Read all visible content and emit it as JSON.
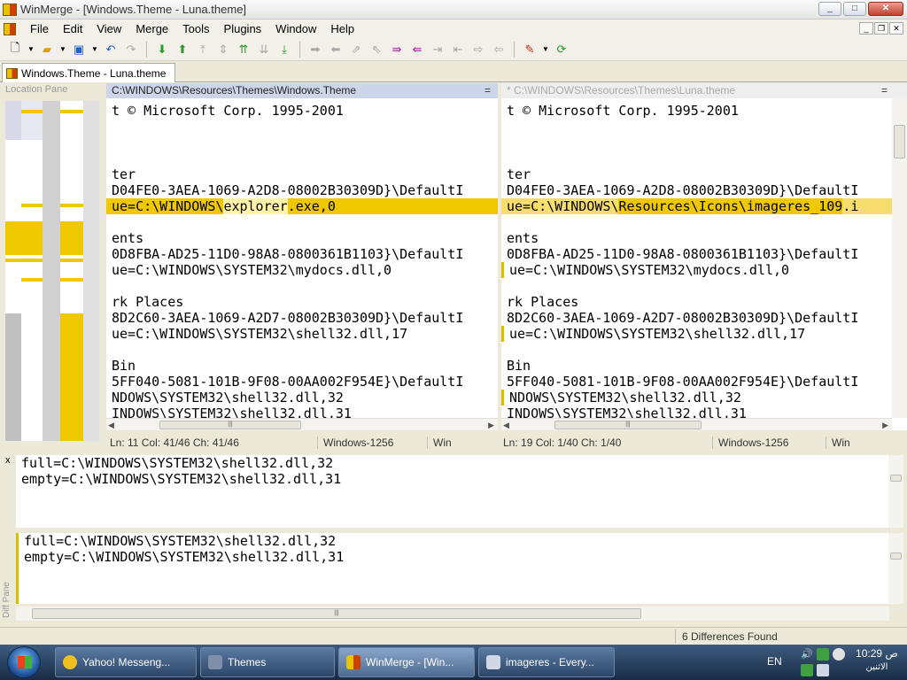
{
  "window": {
    "title": "WinMerge - [Windows.Theme - Luna.theme]",
    "min": "_",
    "max": "□",
    "close": "✕"
  },
  "menu": [
    "File",
    "Edit",
    "View",
    "Merge",
    "Tools",
    "Plugins",
    "Window",
    "Help"
  ],
  "mdi": {
    "min": "_",
    "restore": "❐",
    "close": "✕"
  },
  "doc_tab": {
    "label": "Windows.Theme - Luna.theme"
  },
  "location_pane": {
    "title": "Location Pane"
  },
  "left_pane": {
    "path": "C:\\WINDOWS\\Resources\\Themes\\Windows.Theme",
    "menu_glyph": "=",
    "lines": [
      {
        "segs": [
          "t © Microsoft Corp. 1995-2001"
        ]
      },
      {
        "segs": [
          ""
        ]
      },
      {
        "segs": [
          ""
        ]
      },
      {
        "segs": [
          ""
        ]
      },
      {
        "segs": [
          "ter"
        ]
      },
      {
        "segs": [
          "D04FE0-3AEA-1069-A2D8-08002B30309D}\\DefaultI"
        ]
      },
      {
        "segs": [
          "ue=C:\\WINDOWS\\",
          "explorer",
          ".exe,0"
        ],
        "diff": true
      },
      {
        "segs": [
          ""
        ]
      },
      {
        "segs": [
          "ents"
        ]
      },
      {
        "segs": [
          "0D8FBA-AD25-11D0-98A8-0800361B1103}\\DefaultI"
        ]
      },
      {
        "segs": [
          "ue=C:\\WINDOWS\\SYSTEM32\\mydocs.dll,0"
        ]
      },
      {
        "segs": [
          ""
        ]
      },
      {
        "segs": [
          "rk Places"
        ]
      },
      {
        "segs": [
          "8D2C60-3AEA-1069-A2D7-08002B30309D}\\DefaultI"
        ]
      },
      {
        "segs": [
          "ue=C:\\WINDOWS\\SYSTEM32\\shell32.dll,17"
        ]
      },
      {
        "segs": [
          ""
        ]
      },
      {
        "segs": [
          "Bin"
        ]
      },
      {
        "segs": [
          "5FF040-5081-101B-9F08-00AA002F954E}\\DefaultI"
        ]
      },
      {
        "segs": [
          "NDOWS\\SYSTEM32\\shell32.dll,32"
        ]
      },
      {
        "segs": [
          "INDOWS\\SYSTEM32\\shell32.dll,31"
        ]
      }
    ],
    "status": {
      "pos": "Ln: 11  Col: 41/46  Ch: 41/46",
      "encoding": "Windows-1256",
      "eol": "Win"
    }
  },
  "right_pane": {
    "path": "* C:\\WINDOWS\\Resources\\Themes\\Luna.theme",
    "menu_glyph": "=",
    "lines": [
      {
        "segs": [
          "t © Microsoft Corp. 1995-2001"
        ]
      },
      {
        "segs": [
          ""
        ]
      },
      {
        "segs": [
          ""
        ]
      },
      {
        "segs": [
          ""
        ]
      },
      {
        "segs": [
          "ter"
        ]
      },
      {
        "segs": [
          "D04FE0-3AEA-1069-A2D8-08002B30309D}\\DefaultI"
        ]
      },
      {
        "segs": [
          "ue=C:\\WINDOWS\\",
          "Resources\\Icons\\imageres_109",
          ".i"
        ],
        "diff": true
      },
      {
        "segs": [
          ""
        ]
      },
      {
        "segs": [
          "ents"
        ]
      },
      {
        "segs": [
          "0D8FBA-AD25-11D0-98A8-0800361B1103}\\DefaultI"
        ]
      },
      {
        "segs": [
          "ue=C:\\WINDOWS\\SYSTEM32\\mydocs.dll,0"
        ]
      },
      {
        "segs": [
          ""
        ]
      },
      {
        "segs": [
          "rk Places"
        ]
      },
      {
        "segs": [
          "8D2C60-3AEA-1069-A2D7-08002B30309D}\\DefaultI"
        ]
      },
      {
        "segs": [
          "ue=C:\\WINDOWS\\SYSTEM32\\shell32.dll,17"
        ]
      },
      {
        "segs": [
          ""
        ]
      },
      {
        "segs": [
          "Bin"
        ]
      },
      {
        "segs": [
          "5FF040-5081-101B-9F08-00AA002F954E}\\DefaultI"
        ]
      },
      {
        "segs": [
          "NDOWS\\SYSTEM32\\shell32.dll,32"
        ]
      },
      {
        "segs": [
          "INDOWS\\SYSTEM32\\shell32.dll,31"
        ]
      }
    ],
    "status": {
      "pos": "Ln: 19  Col: 1/40  Ch: 1/40",
      "encoding": "Windows-1256",
      "eol": "Win"
    }
  },
  "diff_pane": {
    "close": "x",
    "label": "Diff Pane",
    "top_lines": [
      "full=C:\\WINDOWS\\SYSTEM32\\shell32.dll,32",
      "empty=C:\\WINDOWS\\SYSTEM32\\shell32.dll,31"
    ],
    "bottom_lines": [
      "full=C:\\WINDOWS\\SYSTEM32\\shell32.dll,32",
      "empty=C:\\WINDOWS\\SYSTEM32\\shell32.dll,31"
    ]
  },
  "status_bar": {
    "differences": "6 Differences Found"
  },
  "taskbar": {
    "items": [
      {
        "label": "Yahoo! Messeng...",
        "icon_color": "#f0c020"
      },
      {
        "label": "Themes",
        "icon_color": "#8090a8"
      },
      {
        "label": "WinMerge - [Win...",
        "icon_color": "#e8c400",
        "active": true
      },
      {
        "label": "imageres - Every...",
        "icon_color": "#d0d8e8"
      }
    ],
    "lang": "EN",
    "clock_time": "10:29 ص",
    "clock_day": "الاثنين"
  },
  "colors": {
    "diff": "#efc800",
    "diff_light": "#f7dd6e",
    "accent": "#cdd6e8"
  }
}
